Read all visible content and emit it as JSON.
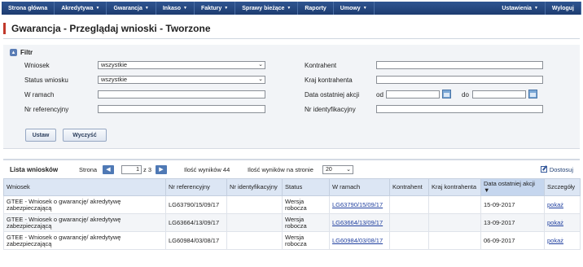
{
  "nav": {
    "left": [
      {
        "label": "Strona główna",
        "dropdown": false
      },
      {
        "label": "Akredytywa",
        "dropdown": true
      },
      {
        "label": "Gwarancja",
        "dropdown": true
      },
      {
        "label": "Inkaso",
        "dropdown": true
      },
      {
        "label": "Faktury",
        "dropdown": true
      },
      {
        "label": "Sprawy bieżące",
        "dropdown": true
      },
      {
        "label": "Raporty",
        "dropdown": false
      },
      {
        "label": "Umowy",
        "dropdown": true
      }
    ],
    "right": [
      {
        "label": "Ustawienia",
        "dropdown": true
      },
      {
        "label": "Wyloguj",
        "dropdown": false
      }
    ]
  },
  "page_title": "Gwarancja - Przeglądaj wnioski - Tworzone",
  "filter": {
    "title": "Filtr",
    "wniosek": {
      "label": "Wniosek",
      "value": "wszystkie"
    },
    "status": {
      "label": "Status wniosku",
      "value": "wszystkie"
    },
    "w_ramach": {
      "label": "W ramach",
      "value": ""
    },
    "nr_ref": {
      "label": "Nr referencyjny",
      "value": ""
    },
    "kontrahent": {
      "label": "Kontrahent",
      "value": ""
    },
    "kraj": {
      "label": "Kraj kontrahenta",
      "value": ""
    },
    "data": {
      "label": "Data ostatniej akcji",
      "od": "od",
      "do": "do",
      "od_value": "",
      "do_value": ""
    },
    "nr_ident": {
      "label": "Nr identyfikacyjny",
      "value": ""
    },
    "apply_label": "Ustaw",
    "clear_label": "Wyczyść"
  },
  "results": {
    "title": "Lista wniosków",
    "page_label": "Strona",
    "page_value": "1",
    "page_of": "z 3",
    "count_text": "Ilość wyników 44",
    "perpage_label": "Ilość wyników na stronie",
    "perpage_value": "20",
    "adjust_label": "Dostosuj",
    "columns": [
      "Wniosek",
      "Nr referencyjny",
      "Nr identyfikacyjny",
      "Status",
      "W ramach",
      "Kontrahent",
      "Kraj kontrahenta",
      "Data ostatniej akcji ▼",
      "Szczegóły"
    ],
    "rows": [
      {
        "wniosek": "GTEE - Wniosek o gwarancję/ akredytywę zabezpieczającą",
        "nr_ref": "LG63790/15/09/17",
        "nr_ident": "",
        "status": "Wersja robocza",
        "w_ramach": "LG63790/15/09/17",
        "kontrahent": "",
        "kraj": "",
        "data": "15-09-2017",
        "szczegoly": "pokaż"
      },
      {
        "wniosek": "GTEE - Wniosek o gwarancję/ akredytywę zabezpieczającą",
        "nr_ref": "LG63664/13/09/17",
        "nr_ident": "",
        "status": "Wersja robocza",
        "w_ramach": "LG63664/13/09/17",
        "kontrahent": "",
        "kraj": "",
        "data": "13-09-2017",
        "szczegoly": "pokaż"
      },
      {
        "wniosek": "GTEE - Wniosek o gwarancję/ akredytywę zabezpieczającą",
        "nr_ref": "LG60984/03/08/17",
        "nr_ident": "",
        "status": "Wersja robocza",
        "w_ramach": "LG60984/03/08/17",
        "kontrahent": "",
        "kraj": "",
        "data": "06-09-2017",
        "szczegoly": "pokaż"
      }
    ]
  }
}
